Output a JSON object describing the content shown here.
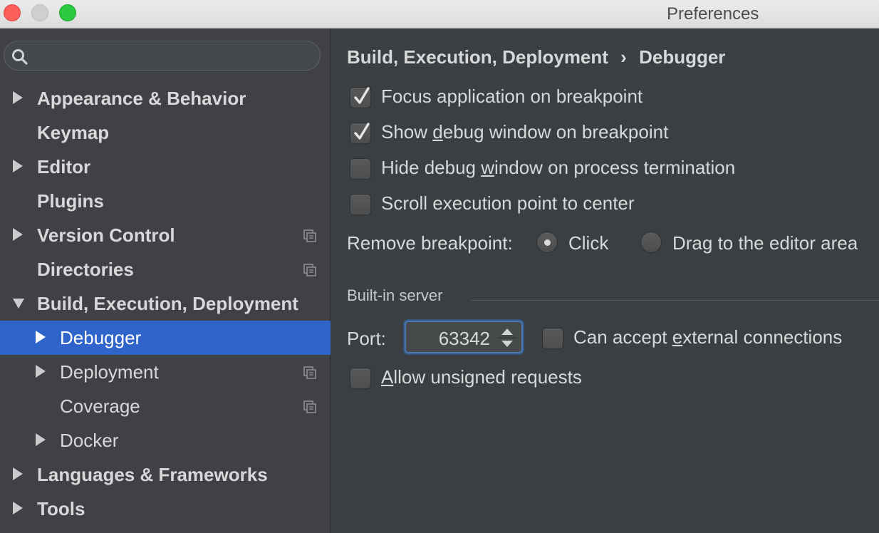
{
  "window": {
    "title": "Preferences"
  },
  "sidebar": {
    "search": {
      "value": "",
      "placeholder": ""
    },
    "items": [
      {
        "label": "Appearance & Behavior",
        "level": 0,
        "bold": true,
        "arrow": "right",
        "project_icon": false,
        "selected": false
      },
      {
        "label": "Keymap",
        "level": 0,
        "bold": true,
        "arrow": "none",
        "project_icon": false,
        "selected": false
      },
      {
        "label": "Editor",
        "level": 0,
        "bold": true,
        "arrow": "right",
        "project_icon": false,
        "selected": false
      },
      {
        "label": "Plugins",
        "level": 0,
        "bold": true,
        "arrow": "none",
        "project_icon": false,
        "selected": false
      },
      {
        "label": "Version Control",
        "level": 0,
        "bold": true,
        "arrow": "right",
        "project_icon": true,
        "selected": false
      },
      {
        "label": "Directories",
        "level": 0,
        "bold": true,
        "arrow": "none",
        "project_icon": true,
        "selected": false
      },
      {
        "label": "Build, Execution, Deployment",
        "level": 0,
        "bold": true,
        "arrow": "down",
        "project_icon": false,
        "selected": false
      },
      {
        "label": "Debugger",
        "level": 1,
        "bold": false,
        "arrow": "right",
        "project_icon": false,
        "selected": true
      },
      {
        "label": "Deployment",
        "level": 1,
        "bold": false,
        "arrow": "right",
        "project_icon": true,
        "selected": false
      },
      {
        "label": "Coverage",
        "level": 1,
        "bold": false,
        "arrow": "none",
        "project_icon": true,
        "selected": false
      },
      {
        "label": "Docker",
        "level": 1,
        "bold": false,
        "arrow": "right",
        "project_icon": false,
        "selected": false
      },
      {
        "label": "Languages & Frameworks",
        "level": 0,
        "bold": true,
        "arrow": "right",
        "project_icon": false,
        "selected": false
      },
      {
        "label": "Tools",
        "level": 0,
        "bold": true,
        "arrow": "right",
        "project_icon": false,
        "selected": false
      }
    ]
  },
  "breadcrumb": {
    "parent": "Build, Execution, Deployment",
    "separator": "›",
    "current": "Debugger"
  },
  "options": {
    "focus_app": {
      "label": "Focus application on breakpoint",
      "checked": true
    },
    "show_debug": {
      "pre": "Show ",
      "mnemonic": "d",
      "post": "ebug window on breakpoint",
      "checked": true
    },
    "hide_debug": {
      "pre": "Hide debug ",
      "mnemonic": "w",
      "post": "indow on process termination",
      "checked": false
    },
    "scroll_exec": {
      "label": "Scroll execution point to center",
      "checked": false
    }
  },
  "remove_breakpoint": {
    "label": "Remove breakpoint:",
    "options": [
      {
        "label": "Click",
        "selected": true
      },
      {
        "label": "Drag to the editor area",
        "selected": false
      }
    ]
  },
  "server": {
    "group_title": "Built-in server",
    "port_label": "Port:",
    "port_value": "63342",
    "external": {
      "pre": "Can accept ",
      "mnemonic": "e",
      "post": "xternal connections",
      "checked": false
    },
    "unsigned": {
      "pre": "",
      "mnemonic": "A",
      "post": "llow unsigned requests",
      "checked": false
    }
  }
}
